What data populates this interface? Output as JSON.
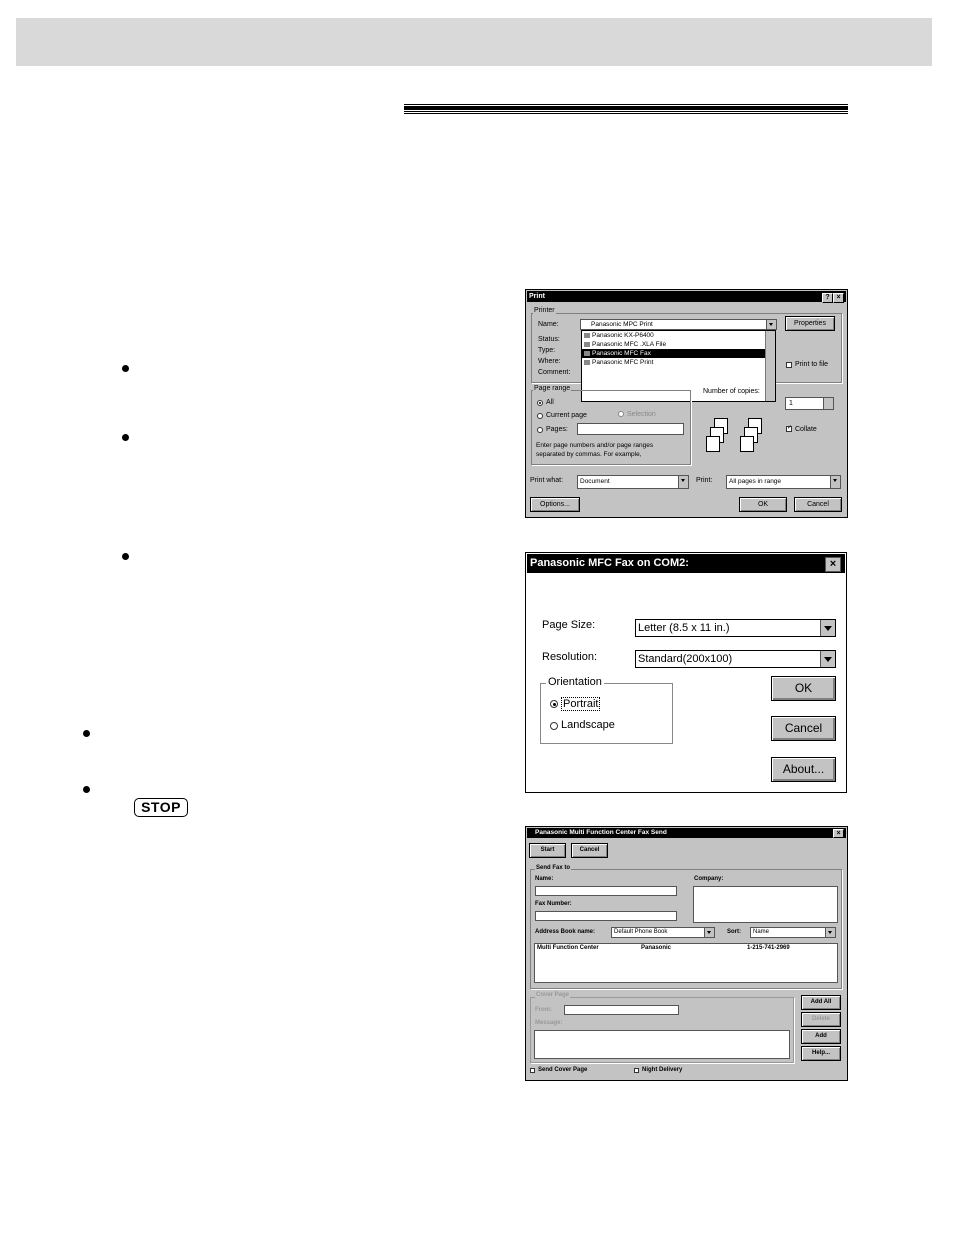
{
  "document": {
    "stop_key": "STOP"
  },
  "print_dialog": {
    "title": "Print",
    "help_btn": "?",
    "close_btn": "×",
    "printer_group": "Printer",
    "name_label": "Name:",
    "name_value": "Panasonic MPC Print",
    "properties_btn": "Properties",
    "status_label": "Status:",
    "type_label": "Type:",
    "where_label": "Where:",
    "comment_label": "Comment:",
    "printer_options": [
      "Panasonic KX-P6400",
      "Panasonic MFC .XLA File",
      "Panasonic MFC Fax",
      "Panasonic MFC Print"
    ],
    "selected_printer": "Panasonic MFC Fax",
    "print_to_file": "Print to file",
    "page_range_group": "Page range",
    "all_label": "All",
    "current_page_label": "Current page",
    "selection_label": "Selection",
    "pages_label": "Pages:",
    "hint_line1": "Enter page numbers and/or page ranges",
    "hint_line2": "separated by commas. For example,",
    "copies_label": "Number of copies:",
    "copies_value": "1",
    "collate_label": "Collate",
    "print_what_label": "Print what:",
    "print_what_value": "Document",
    "print_label": "Print:",
    "print_value": "All pages in range",
    "options_btn": "Options...",
    "ok_btn": "OK",
    "cancel_btn": "Cancel"
  },
  "fax_props_dialog": {
    "title": "Panasonic MFC Fax on COM2:",
    "close_btn": "×",
    "page_size_label": "Page Size:",
    "page_size_value": "Letter (8.5 x 11 in.)",
    "resolution_label": "Resolution:",
    "resolution_value": "Standard(200x100)",
    "orientation_group": "Orientation",
    "portrait_label": "Portrait",
    "landscape_label": "Landscape",
    "ok_btn": "OK",
    "cancel_btn": "Cancel",
    "about_btn": "About..."
  },
  "fax_send_dialog": {
    "title": "Panasonic Multi Function Center Fax Send",
    "close_btn": "×",
    "start_btn": "Start",
    "cancel_btn": "Cancel",
    "send_fax_group": "Send Fax to",
    "name_label": "Name:",
    "company_label": "Company:",
    "fax_number_label": "Fax Number:",
    "address_book_label": "Address Book name:",
    "address_book_value": "Default Phone Book",
    "sort_label": "Sort:",
    "sort_value": "Name",
    "entries": [
      {
        "name": "Multi Function Center",
        "company": "Panasonic",
        "fax": "1-215-741-2969"
      }
    ],
    "cover_page_group": "Cover Page",
    "from_label": "From:",
    "message_label": "Message:",
    "add_all_btn": "Add All",
    "delete_btn": "Delete",
    "add_btn": "Add",
    "help_btn": "Help...",
    "send_cover_page": "Send Cover Page",
    "night_delivery": "Night Delivery"
  }
}
